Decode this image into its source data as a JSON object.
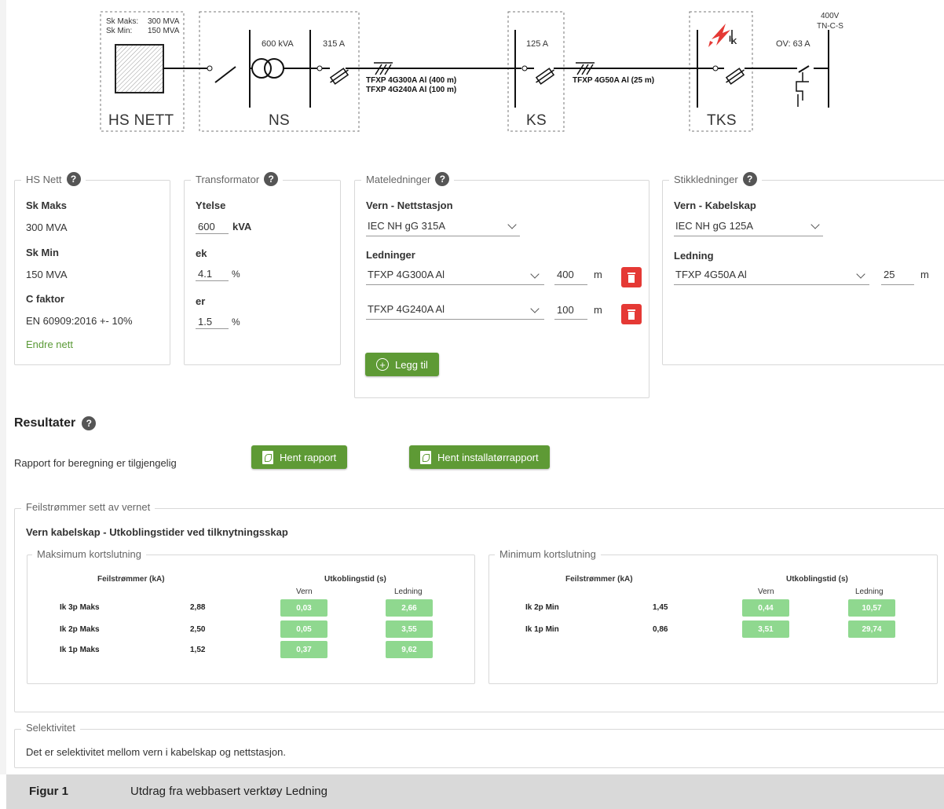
{
  "diagram": {
    "hs_nett": {
      "sk_maks_label": "Sk Maks:",
      "sk_maks_value": "300 MVA",
      "sk_min_label": "Sk Min:",
      "sk_min_value": "150 MVA",
      "label": "HS NETT"
    },
    "ns": {
      "label": "NS",
      "kva": "600 kVA",
      "fuse": "315 A"
    },
    "cable1": {
      "line1": "TFXP 4G300A Al (400 m)",
      "line2": "TFXP 4G240A Al (100 m)"
    },
    "ks": {
      "label": "KS",
      "fuse": "125 A"
    },
    "cable2": {
      "line1": "TFXP 4G50A Al (25 m)"
    },
    "tks": {
      "label": "TKS",
      "ik_label": "I",
      "ik_sub": "K"
    },
    "right": {
      "ov": "OV: 63 A",
      "voltage": "400V",
      "system": "TN-C-S"
    }
  },
  "hs_nett_panel": {
    "title": "HS Nett",
    "sk_maks_label": "Sk Maks",
    "sk_maks_value": "300 MVA",
    "sk_min_label": "Sk Min",
    "sk_min_value": "150 MVA",
    "c_faktor_label": "C faktor",
    "c_faktor_value": "EN 60909:2016 +- 10%",
    "change_link": "Endre nett"
  },
  "transformator_panel": {
    "title": "Transformator",
    "ytelse_label": "Ytelse",
    "ytelse_value": "600",
    "ytelse_unit": "kVA",
    "ek_label": "ek",
    "ek_value": "4.1",
    "ek_unit": "%",
    "er_label": "er",
    "er_value": "1.5",
    "er_unit": "%"
  },
  "mateledninger_panel": {
    "title": "Mateledninger",
    "vern_label": "Vern - Nettstasjon",
    "vern_value": "IEC NH gG 315A",
    "ledninger_label": "Ledninger",
    "rows": [
      {
        "cable": "TFXP 4G300A Al",
        "length": "400",
        "unit": "m"
      },
      {
        "cable": "TFXP 4G240A Al",
        "length": "100",
        "unit": "m"
      }
    ],
    "add_button": "Legg til"
  },
  "stikkledninger_panel": {
    "title": "Stikkledninger",
    "vern_label": "Vern - Kabelskap",
    "vern_value": "IEC NH gG 125A",
    "ledning_label": "Ledning",
    "ledning_value": "TFXP 4G50A Al",
    "length": "25",
    "unit": "m"
  },
  "resultater": {
    "title": "Resultater",
    "report_text": "Rapport for beregning er tilgjengelig",
    "btn_report": "Hent rapport",
    "btn_installer": "Hent installatørrapport"
  },
  "feilstrommer": {
    "legend": "Feilstrømmer sett av vernet",
    "heading": "Vern kabelskap - Utkoblingstider ved tilknytningsskap",
    "max": {
      "legend": "Maksimum kortslutning",
      "col_current": "Feilstrømmer (kA)",
      "col_time": "Utkoblingstid (s)",
      "col_vern": "Vern",
      "col_ledning": "Ledning",
      "rows": [
        {
          "label": "Ik 3p Maks",
          "current": "2,88",
          "vern": "0,03",
          "ledning": "2,66"
        },
        {
          "label": "Ik 2p Maks",
          "current": "2,50",
          "vern": "0,05",
          "ledning": "3,55"
        },
        {
          "label": "Ik 1p Maks",
          "current": "1,52",
          "vern": "0,37",
          "ledning": "9,62"
        }
      ]
    },
    "min": {
      "legend": "Minimum kortslutning",
      "col_current": "Feilstrømmer (kA)",
      "col_time": "Utkoblingstid (s)",
      "col_vern": "Vern",
      "col_ledning": "Ledning",
      "rows": [
        {
          "label": "Ik 2p Min",
          "current": "1,45",
          "vern": "0,44",
          "ledning": "10,57"
        },
        {
          "label": "Ik 1p Min",
          "current": "0,86",
          "vern": "3,51",
          "ledning": "29,74"
        }
      ]
    }
  },
  "selektivitet": {
    "legend": "Selektivitet",
    "text": "Det er selektivitet mellom vern i kabelskap og nettstasjon."
  },
  "caption": {
    "label": "Figur 1",
    "text": "Utdrag fra webbasert verktøy Ledning"
  },
  "colors": {
    "accent_green": "#5e9a35",
    "pill_green": "#8fd88f",
    "delete_red": "#e53935"
  }
}
